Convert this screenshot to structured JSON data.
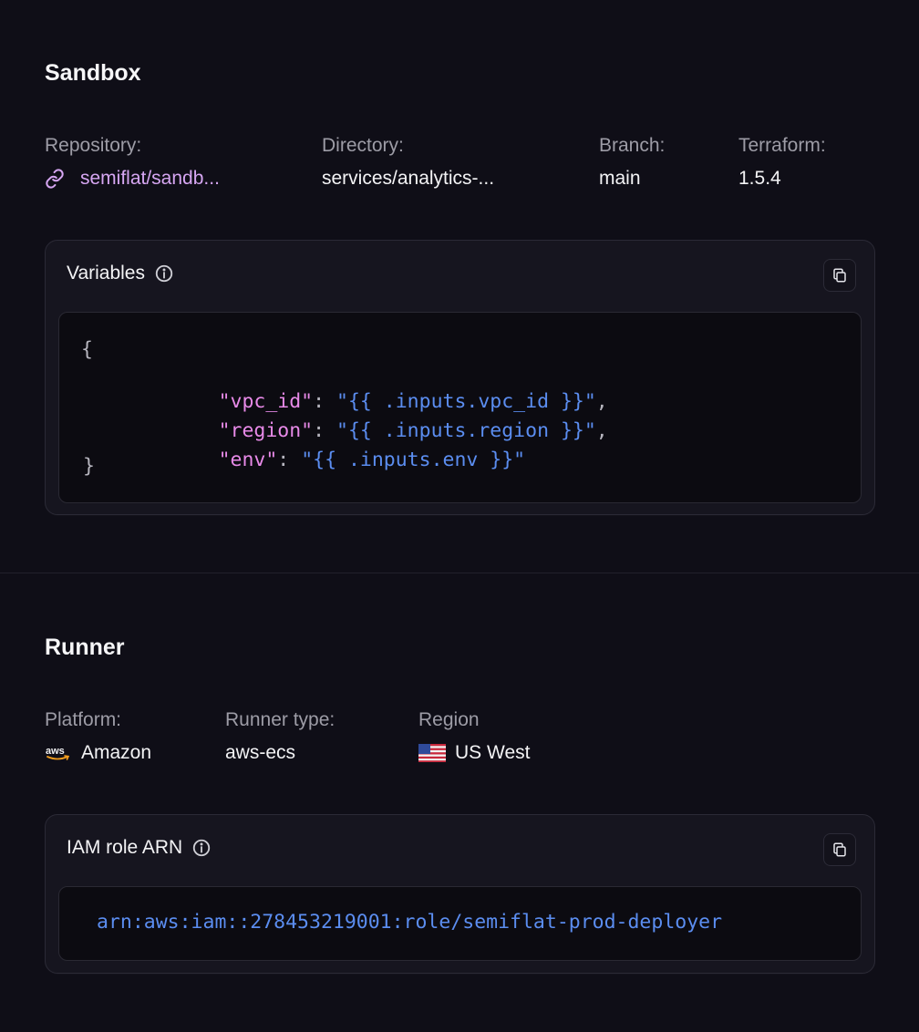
{
  "sandbox": {
    "title": "Sandbox",
    "repository": {
      "label": "Repository:",
      "value": "semiflat/sandb..."
    },
    "directory": {
      "label": "Directory:",
      "value": "services/analytics-..."
    },
    "branch": {
      "label": "Branch:",
      "value": "main"
    },
    "terraform": {
      "label": "Terraform:",
      "value": "1.5.4"
    },
    "variables": {
      "title": "Variables",
      "open_brace": "{",
      "close_brace": "}",
      "lines": [
        {
          "key": "\"vpc_id\"",
          "value": "\"{{ .inputs.vpc_id }}\"",
          "trail": ","
        },
        {
          "key": "\"region\"",
          "value": "\"{{ .inputs.region }}\"",
          "trail": ","
        },
        {
          "key": "\"env\"",
          "value": "\"{{ .inputs.env }}\"",
          "trail": ""
        }
      ]
    }
  },
  "runner": {
    "title": "Runner",
    "platform": {
      "label": "Platform:",
      "value": "Amazon"
    },
    "runner_type": {
      "label": "Runner type:",
      "value": "aws-ecs"
    },
    "region": {
      "label": "Region",
      "value": "US West"
    },
    "iam": {
      "title": "IAM role ARN",
      "value": "arn:aws:iam::278453219001:role/semiflat-prod-deployer"
    }
  },
  "icons": {
    "link": "link-icon",
    "info": "info-icon",
    "copy": "copy-icon",
    "aws": "aws-logo-icon",
    "flag": "us-flag-icon"
  },
  "colors": {
    "background": "#0f0e17",
    "link": "#d6a6f2",
    "json_key": "#e88ae8",
    "json_string": "#5b8df0"
  }
}
